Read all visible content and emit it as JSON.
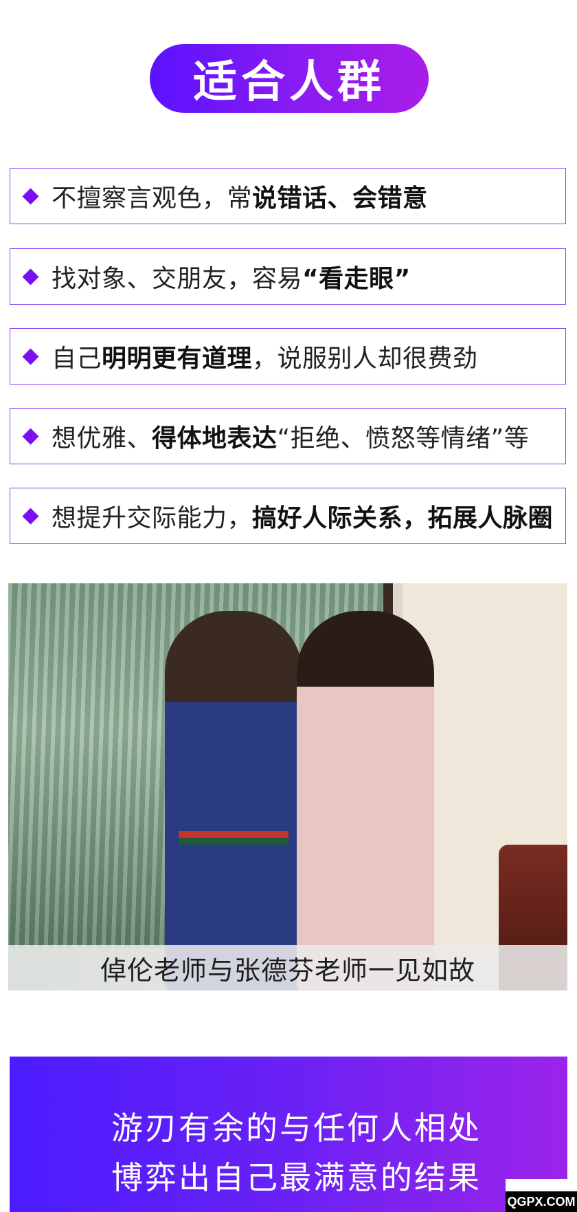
{
  "header": {
    "title": "适合人群"
  },
  "items": [
    {
      "plain1": "不擅察言观色，常",
      "bold": "说错话、会错意",
      "plain2": ""
    },
    {
      "plain1": "找对象、交朋友，容易",
      "bold": "“看走眼”",
      "plain2": ""
    },
    {
      "plain1": "自己",
      "bold": "明明更有道理",
      "plain2": "，说服别人却很费劲"
    },
    {
      "plain1": "想优雅、",
      "bold": "得体地表达",
      "plain2": "“拒绝、愤怒等情绪”等"
    },
    {
      "plain1": "想提升交际能力，",
      "bold": "搞好人际关系，拓展人脉圈",
      "plain2": ""
    }
  ],
  "photo": {
    "caption": "倬伦老师与张德芬老师一见如故"
  },
  "banner": {
    "line1": "游刃有余的与任何人相处",
    "line2": "博弈出自己最满意的结果"
  },
  "watermark": {
    "text": "QGPX.COM"
  },
  "colors": {
    "accent": "#7a0ff0",
    "border": "#8a3df2",
    "gradient_start": "#4b1cff",
    "gradient_end": "#9b24ea"
  }
}
